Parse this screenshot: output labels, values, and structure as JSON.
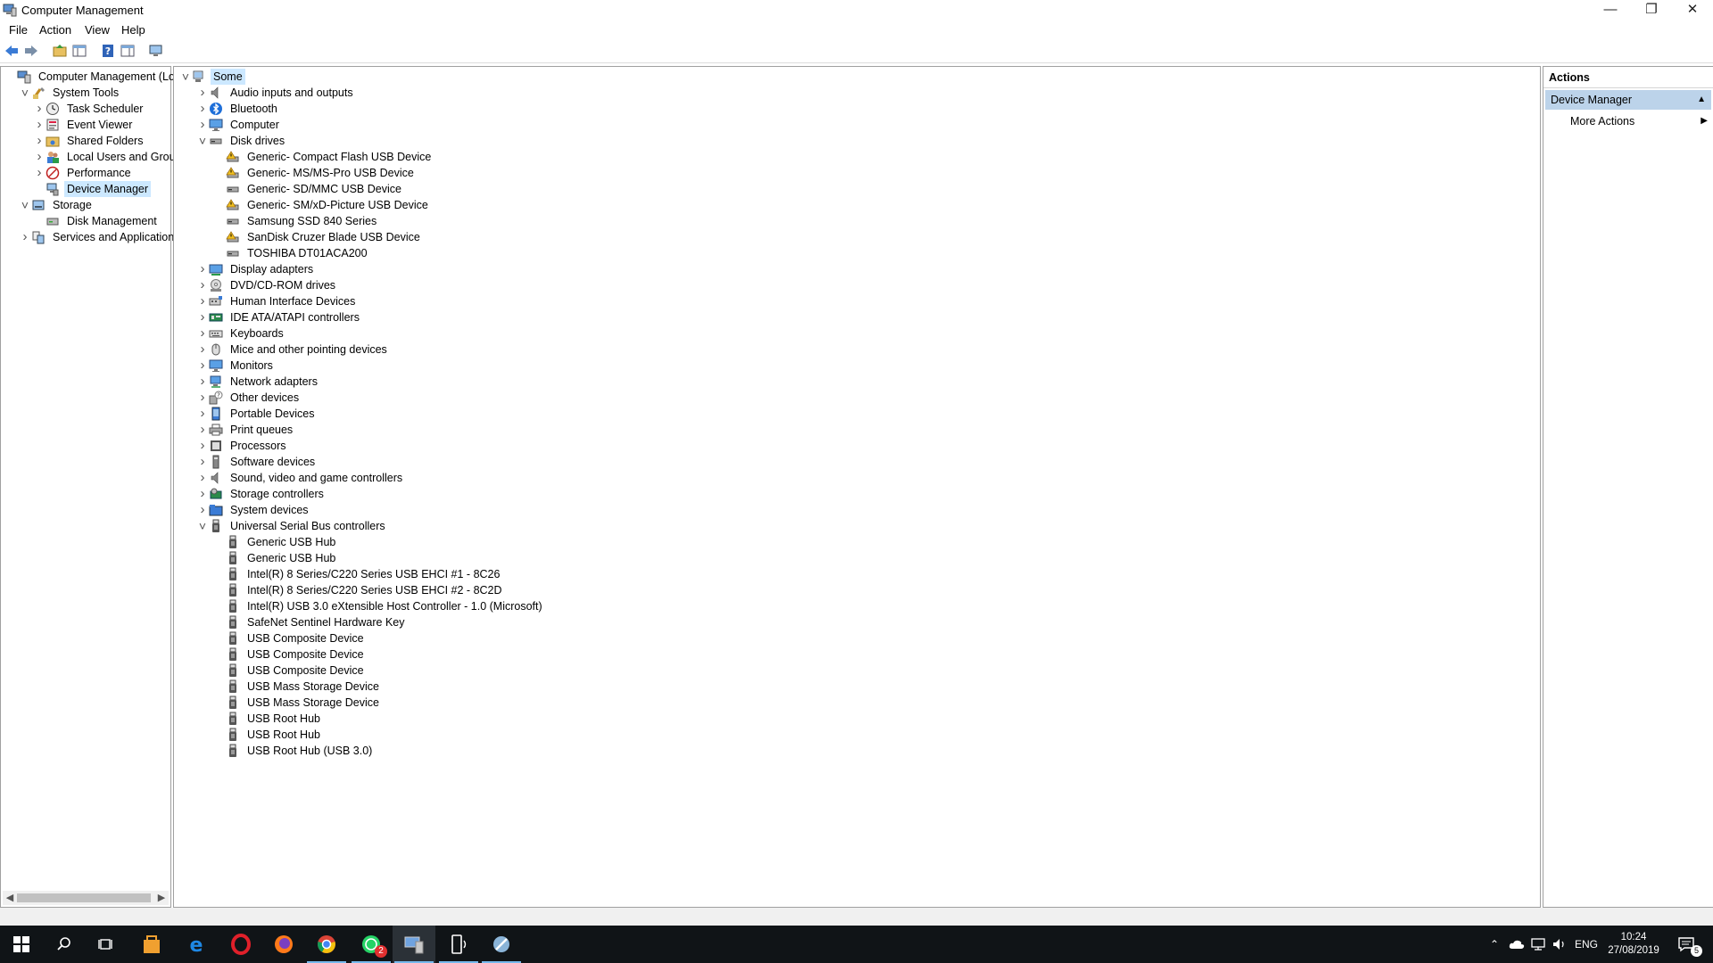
{
  "window": {
    "title": "Computer Management",
    "minimize_glyph": "—",
    "restore_glyph": "❐",
    "close_glyph": "✕"
  },
  "menu": {
    "items": [
      "File",
      "Action",
      "View",
      "Help"
    ]
  },
  "left_tree": [
    {
      "label": "Computer Management (Local",
      "icon": "computer-management-icon",
      "expander": "none",
      "level": 0
    },
    {
      "label": "System Tools",
      "icon": "system-tools-icon",
      "expander": "expanded",
      "level": 1
    },
    {
      "label": "Task Scheduler",
      "icon": "task-scheduler-icon",
      "expander": "collapsed",
      "level": 2
    },
    {
      "label": "Event Viewer",
      "icon": "event-viewer-icon",
      "expander": "collapsed",
      "level": 2
    },
    {
      "label": "Shared Folders",
      "icon": "shared-folders-icon",
      "expander": "collapsed",
      "level": 2
    },
    {
      "label": "Local Users and Groups",
      "icon": "local-users-icon",
      "expander": "collapsed",
      "level": 2
    },
    {
      "label": "Performance",
      "icon": "performance-icon",
      "expander": "collapsed",
      "level": 2
    },
    {
      "label": "Device Manager",
      "icon": "device-manager-icon",
      "expander": "none",
      "level": 2,
      "selected": true
    },
    {
      "label": "Storage",
      "icon": "storage-icon",
      "expander": "expanded",
      "level": 1
    },
    {
      "label": "Disk Management",
      "icon": "disk-management-icon",
      "expander": "none",
      "level": 2
    },
    {
      "label": "Services and Applications",
      "icon": "services-applications-icon",
      "expander": "collapsed",
      "level": 1
    }
  ],
  "device_tree": [
    {
      "label": "Some",
      "icon": "computer-root-icon",
      "expander": "expanded",
      "level": 0,
      "selected": true
    },
    {
      "label": "Audio inputs and outputs",
      "icon": "speaker-icon",
      "expander": "collapsed",
      "level": 1
    },
    {
      "label": "Bluetooth",
      "icon": "bluetooth-icon",
      "expander": "collapsed",
      "level": 1
    },
    {
      "label": "Computer",
      "icon": "monitor-icon",
      "expander": "collapsed",
      "level": 1
    },
    {
      "label": "Disk drives",
      "icon": "disk-drive-icon",
      "expander": "expanded",
      "level": 1
    },
    {
      "label": "Generic- Compact Flash USB Device",
      "icon": "warning-drive-icon",
      "expander": "none",
      "level": 2
    },
    {
      "label": "Generic- MS/MS-Pro USB Device",
      "icon": "warning-drive-icon",
      "expander": "none",
      "level": 2
    },
    {
      "label": "Generic- SD/MMC USB Device",
      "icon": "disk-drive-icon",
      "expander": "none",
      "level": 2
    },
    {
      "label": "Generic- SM/xD-Picture USB Device",
      "icon": "warning-drive-icon",
      "expander": "none",
      "level": 2
    },
    {
      "label": "Samsung SSD 840 Series",
      "icon": "disk-drive-icon",
      "expander": "none",
      "level": 2
    },
    {
      "label": "SanDisk Cruzer Blade USB Device",
      "icon": "warning-drive-icon",
      "expander": "none",
      "level": 2
    },
    {
      "label": "TOSHIBA DT01ACA200",
      "icon": "disk-drive-icon",
      "expander": "none",
      "level": 2
    },
    {
      "label": "Display adapters",
      "icon": "display-adapter-icon",
      "expander": "collapsed",
      "level": 1
    },
    {
      "label": "DVD/CD-ROM drives",
      "icon": "dvd-icon",
      "expander": "collapsed",
      "level": 1
    },
    {
      "label": "Human Interface Devices",
      "icon": "hid-icon",
      "expander": "collapsed",
      "level": 1
    },
    {
      "label": "IDE ATA/ATAPI controllers",
      "icon": "ide-controller-icon",
      "expander": "collapsed",
      "level": 1
    },
    {
      "label": "Keyboards",
      "icon": "keyboard-icon",
      "expander": "collapsed",
      "level": 1
    },
    {
      "label": "Mice and other pointing devices",
      "icon": "mouse-icon",
      "expander": "collapsed",
      "level": 1
    },
    {
      "label": "Monitors",
      "icon": "monitor-icon",
      "expander": "collapsed",
      "level": 1
    },
    {
      "label": "Network adapters",
      "icon": "network-adapter-icon",
      "expander": "collapsed",
      "level": 1
    },
    {
      "label": "Other devices",
      "icon": "unknown-device-icon",
      "expander": "collapsed",
      "level": 1
    },
    {
      "label": "Portable Devices",
      "icon": "portable-device-icon",
      "expander": "collapsed",
      "level": 1
    },
    {
      "label": "Print queues",
      "icon": "printer-icon",
      "expander": "collapsed",
      "level": 1
    },
    {
      "label": "Processors",
      "icon": "processor-icon",
      "expander": "collapsed",
      "level": 1
    },
    {
      "label": "Software devices",
      "icon": "software-device-icon",
      "expander": "collapsed",
      "level": 1
    },
    {
      "label": "Sound, video and game controllers",
      "icon": "speaker-icon",
      "expander": "collapsed",
      "level": 1
    },
    {
      "label": "Storage controllers",
      "icon": "storage-controller-icon",
      "expander": "collapsed",
      "level": 1
    },
    {
      "label": "System devices",
      "icon": "system-devices-icon",
      "expander": "collapsed",
      "level": 1
    },
    {
      "label": "Universal Serial Bus controllers",
      "icon": "usb-icon",
      "expander": "expanded",
      "level": 1
    },
    {
      "label": "Generic USB Hub",
      "icon": "usb-icon",
      "expander": "none",
      "level": 2
    },
    {
      "label": "Generic USB Hub",
      "icon": "usb-icon",
      "expander": "none",
      "level": 2
    },
    {
      "label": "Intel(R) 8 Series/C220 Series USB EHCI #1 - 8C26",
      "icon": "usb-icon",
      "expander": "none",
      "level": 2
    },
    {
      "label": "Intel(R) 8 Series/C220 Series USB EHCI #2 - 8C2D",
      "icon": "usb-icon",
      "expander": "none",
      "level": 2
    },
    {
      "label": "Intel(R) USB 3.0 eXtensible Host Controller - 1.0 (Microsoft)",
      "icon": "usb-icon",
      "expander": "none",
      "level": 2
    },
    {
      "label": "SafeNet Sentinel Hardware Key",
      "icon": "usb-icon",
      "expander": "none",
      "level": 2
    },
    {
      "label": "USB Composite Device",
      "icon": "usb-icon",
      "expander": "none",
      "level": 2
    },
    {
      "label": "USB Composite Device",
      "icon": "usb-icon",
      "expander": "none",
      "level": 2
    },
    {
      "label": "USB Composite Device",
      "icon": "usb-icon",
      "expander": "none",
      "level": 2
    },
    {
      "label": "USB Mass Storage Device",
      "icon": "usb-icon",
      "expander": "none",
      "level": 2
    },
    {
      "label": "USB Mass Storage Device",
      "icon": "usb-icon",
      "expander": "none",
      "level": 2
    },
    {
      "label": "USB Root Hub",
      "icon": "usb-icon",
      "expander": "none",
      "level": 2
    },
    {
      "label": "USB Root Hub",
      "icon": "usb-icon",
      "expander": "none",
      "level": 2
    },
    {
      "label": "USB Root Hub (USB 3.0)",
      "icon": "usb-icon",
      "expander": "none",
      "level": 2
    }
  ],
  "actions": {
    "header": "Actions",
    "section": "Device Manager",
    "more": "More Actions"
  },
  "taskbar": {
    "language": "ENG",
    "time": "10:24",
    "date": "27/08/2019",
    "whatsapp_badge": "2",
    "notification_count": "5"
  },
  "colors": {
    "selection": "#cce8ff",
    "actions_selected": "#bcd3ea",
    "taskbar": "#101417",
    "accent": "#0078d7"
  }
}
